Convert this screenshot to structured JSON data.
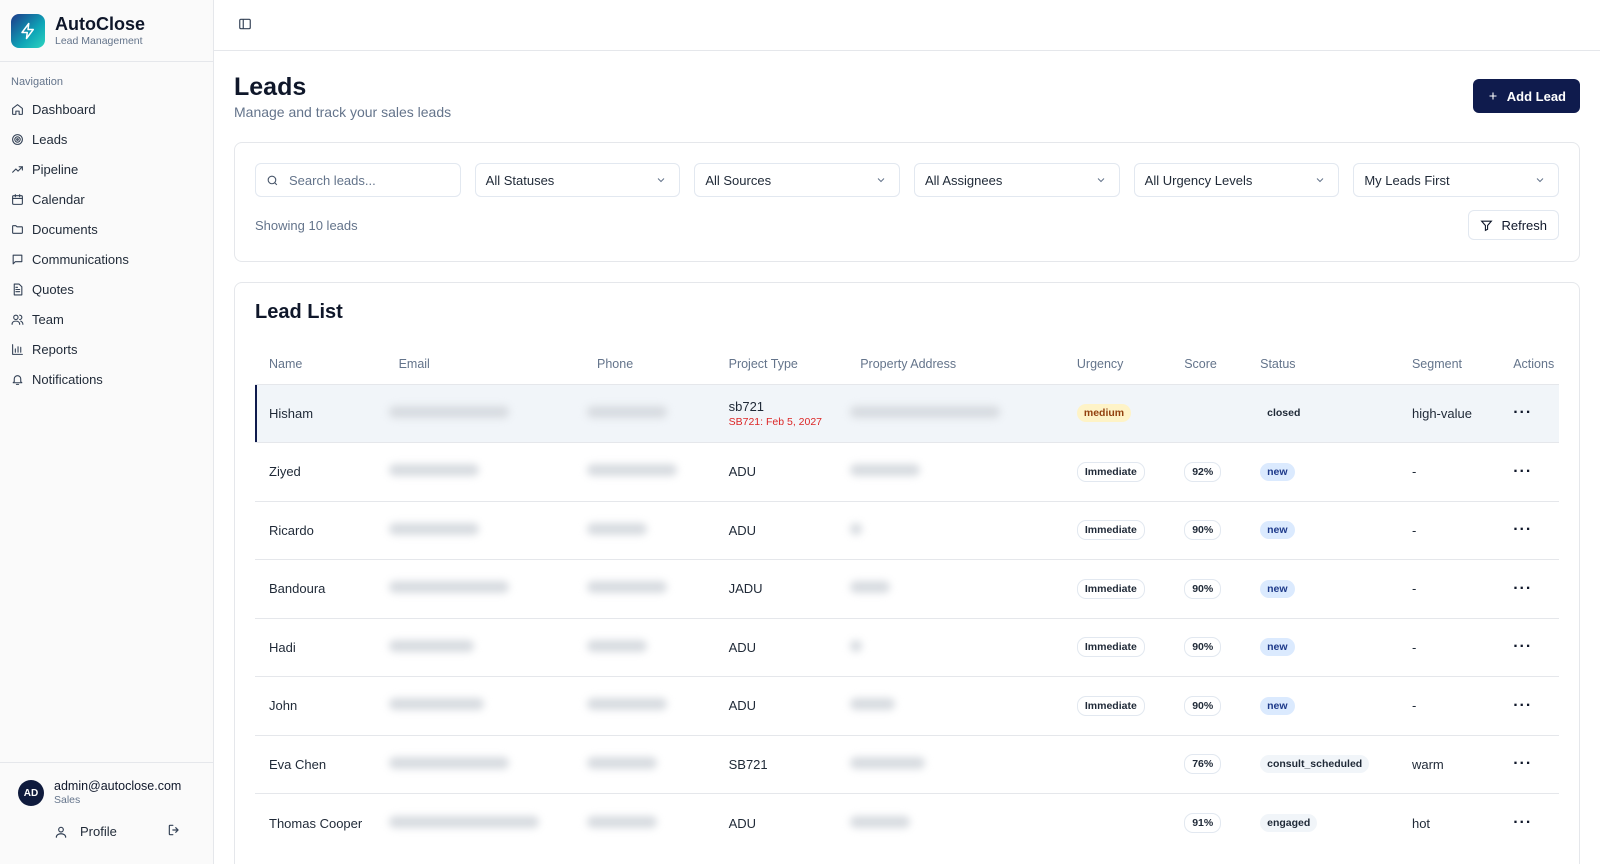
{
  "brand": {
    "name": "AutoClose",
    "subtitle": "Lead Management"
  },
  "nav": {
    "heading": "Navigation",
    "items": [
      {
        "label": "Dashboard",
        "icon": "home-icon"
      },
      {
        "label": "Leads",
        "icon": "target-icon"
      },
      {
        "label": "Pipeline",
        "icon": "trending-up-icon"
      },
      {
        "label": "Calendar",
        "icon": "calendar-icon"
      },
      {
        "label": "Documents",
        "icon": "folder-icon"
      },
      {
        "label": "Communications",
        "icon": "message-icon"
      },
      {
        "label": "Quotes",
        "icon": "file-text-icon"
      },
      {
        "label": "Team",
        "icon": "users-icon"
      },
      {
        "label": "Reports",
        "icon": "bar-chart-icon"
      },
      {
        "label": "Notifications",
        "icon": "bell-icon"
      }
    ]
  },
  "user": {
    "initials": "AD",
    "email": "admin@autoclose.com",
    "role": "Sales",
    "profile_label": "Profile"
  },
  "page": {
    "title": "Leads",
    "subtitle": "Manage and track your sales leads",
    "add_label": "Add Lead"
  },
  "filters": {
    "search_placeholder": "Search leads...",
    "status": "All Statuses",
    "source": "All Sources",
    "assignee": "All Assignees",
    "urgency": "All Urgency Levels",
    "sort": "My Leads First",
    "showing": "Showing 10 leads",
    "refresh_label": "Refresh"
  },
  "list": {
    "title": "Lead List",
    "columns": [
      "Name",
      "Email",
      "Phone",
      "Project Type",
      "Property Address",
      "Urgency",
      "Score",
      "Status",
      "Segment",
      "Actions"
    ],
    "rows": [
      {
        "name": "Hisham",
        "project": "sb721",
        "project_note": "SB721: Feb 5, 2027",
        "urgency": "medium",
        "score": "",
        "status": "closed",
        "segment": "high-value"
      },
      {
        "name": "Ziyed",
        "project": "ADU",
        "project_note": "",
        "urgency": "Immediate",
        "score": "92%",
        "status": "new",
        "segment": "-"
      },
      {
        "name": "Ricardo",
        "project": "ADU",
        "project_note": "",
        "urgency": "Immediate",
        "score": "90%",
        "status": "new",
        "segment": "-"
      },
      {
        "name": "Bandoura",
        "project": "JADU",
        "project_note": "",
        "urgency": "Immediate",
        "score": "90%",
        "status": "new",
        "segment": "-"
      },
      {
        "name": "Hadi",
        "project": "ADU",
        "project_note": "",
        "urgency": "Immediate",
        "score": "90%",
        "status": "new",
        "segment": "-"
      },
      {
        "name": "John",
        "project": "ADU",
        "project_note": "",
        "urgency": "Immediate",
        "score": "90%",
        "status": "new",
        "segment": "-"
      },
      {
        "name": "Eva Chen",
        "project": "SB721",
        "project_note": "",
        "urgency": "",
        "score": "76%",
        "status": "consult_scheduled",
        "segment": "warm"
      },
      {
        "name": "Thomas Cooper",
        "project": "ADU",
        "project_note": "",
        "urgency": "",
        "score": "91%",
        "status": "engaged",
        "segment": "hot"
      }
    ]
  }
}
